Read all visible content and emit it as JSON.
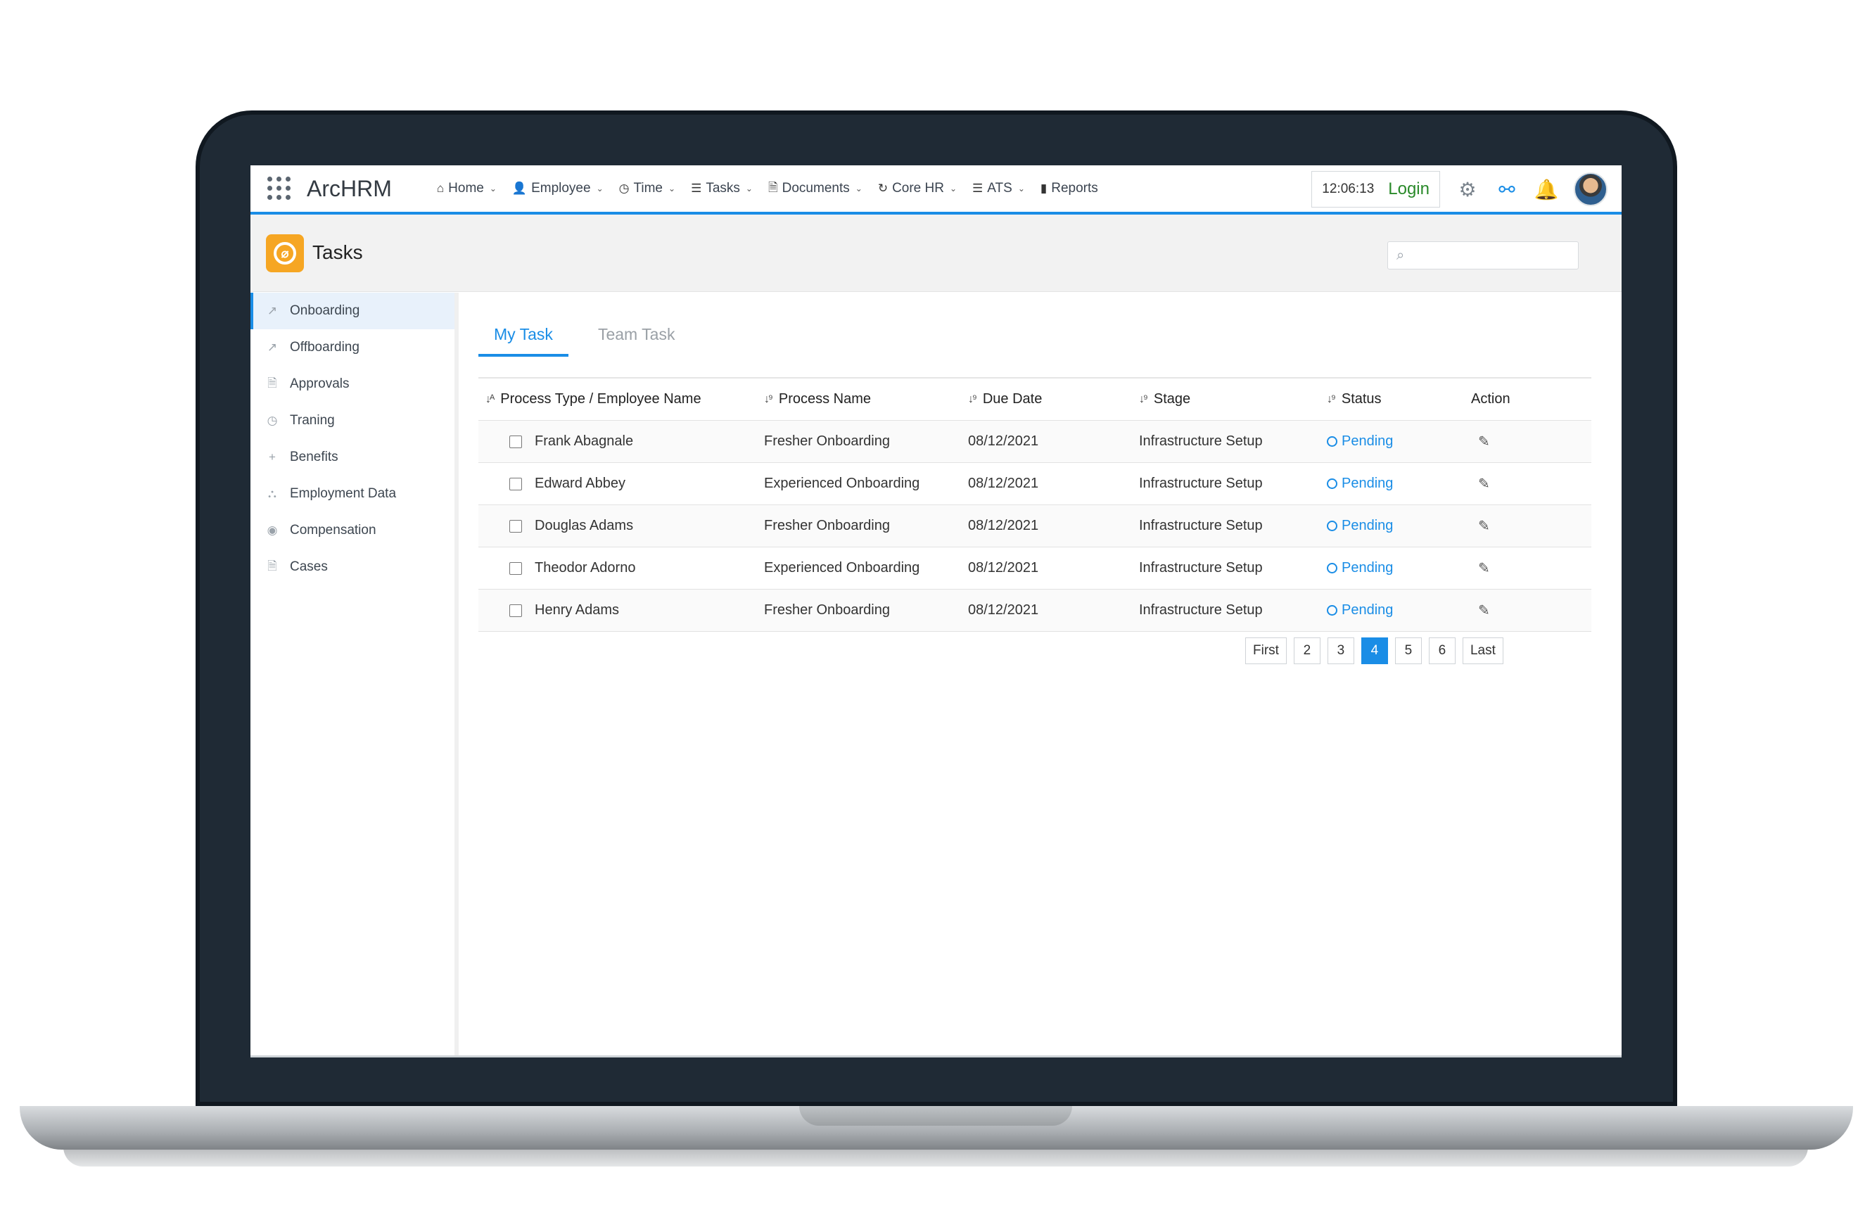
{
  "app": {
    "brand": "ArcHRM"
  },
  "nav": {
    "items": [
      {
        "label": "Home",
        "icon": "home-icon",
        "glyph": "⌂",
        "dropdown": true
      },
      {
        "label": "Employee",
        "icon": "user-icon",
        "glyph": "👤",
        "dropdown": true
      },
      {
        "label": "Time",
        "icon": "clock-icon",
        "glyph": "◷",
        "dropdown": true
      },
      {
        "label": "Tasks",
        "icon": "tasks-icon",
        "glyph": "☰",
        "dropdown": true
      },
      {
        "label": "Documents",
        "icon": "document-icon",
        "glyph": "🗎",
        "dropdown": true
      },
      {
        "label": "Core HR",
        "icon": "refresh-icon",
        "glyph": "↻",
        "dropdown": true
      },
      {
        "label": "ATS",
        "icon": "list-icon",
        "glyph": "☰",
        "dropdown": true
      },
      {
        "label": "Reports",
        "icon": "bar-chart-icon",
        "glyph": "▮",
        "dropdown": false
      }
    ],
    "clock": "12:06:13",
    "login_label": "Login"
  },
  "header": {
    "title": "Tasks",
    "search_placeholder": ""
  },
  "sidebar": {
    "items": [
      {
        "label": "Onboarding",
        "icon": "external-link-icon",
        "glyph": "↗",
        "active": true
      },
      {
        "label": "Offboarding",
        "icon": "external-link-icon",
        "glyph": "↗",
        "active": false
      },
      {
        "label": "Approvals",
        "icon": "document-icon",
        "glyph": "🗎",
        "active": false
      },
      {
        "label": "Traning",
        "icon": "clock-icon",
        "glyph": "◷",
        "active": false
      },
      {
        "label": "Benefits",
        "icon": "plus-icon",
        "glyph": "+",
        "active": false
      },
      {
        "label": "Employment Data",
        "icon": "sitemap-icon",
        "glyph": "⛬",
        "active": false
      },
      {
        "label": "Compensation",
        "icon": "user-circle-icon",
        "glyph": "◉",
        "active": false
      },
      {
        "label": "Cases",
        "icon": "document-icon",
        "glyph": "🗎",
        "active": false
      }
    ]
  },
  "tabs": [
    {
      "label": "My Task",
      "active": true
    },
    {
      "label": "Team Task",
      "active": false
    }
  ],
  "table": {
    "columns": [
      "Process Type / Employee Name",
      "Process Name",
      "Due Date",
      "Stage",
      "Status",
      "Action"
    ],
    "rows": [
      {
        "name": "Frank Abagnale",
        "process": "Fresher Onboarding",
        "due": "08/12/2021",
        "stage": "Infrastructure Setup",
        "status": "Pending"
      },
      {
        "name": "Edward Abbey",
        "process": "Experienced Onboarding",
        "due": "08/12/2021",
        "stage": "Infrastructure Setup",
        "status": "Pending"
      },
      {
        "name": "Douglas Adams",
        "process": "Fresher Onboarding",
        "due": "08/12/2021",
        "stage": "Infrastructure Setup",
        "status": "Pending"
      },
      {
        "name": "Theodor Adorno",
        "process": "Experienced Onboarding",
        "due": "08/12/2021",
        "stage": "Infrastructure Setup",
        "status": "Pending"
      },
      {
        "name": "Henry Adams",
        "process": "Fresher Onboarding",
        "due": "08/12/2021",
        "stage": "Infrastructure Setup",
        "status": "Pending"
      }
    ]
  },
  "pagination": {
    "first": "First",
    "last": "Last",
    "pages": [
      "2",
      "3",
      "4",
      "5",
      "6"
    ],
    "current": "4"
  },
  "colors": {
    "accent": "#1a8de6",
    "logo": "#f6a623",
    "login": "#2a8a2a"
  }
}
